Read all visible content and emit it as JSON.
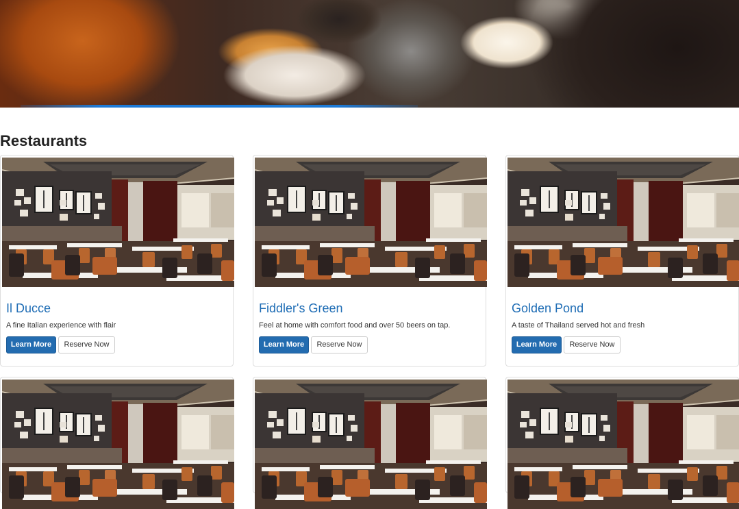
{
  "hero": {
    "image": "restaurant-dining-photo"
  },
  "page": {
    "heading": "Restaurants"
  },
  "restaurants": [
    {
      "name": "Il Ducce",
      "description": "A fine Italian experience with flair",
      "learn_more": "Learn More",
      "reserve": "Reserve Now"
    },
    {
      "name": "Fiddler's Green",
      "description": "Feel at home with comfort food and over 50 beers on tap.",
      "learn_more": "Learn More",
      "reserve": "Reserve Now"
    },
    {
      "name": "Golden Pond",
      "description": "A taste of Thailand served hot and fresh",
      "learn_more": "Learn More",
      "reserve": "Reserve Now"
    },
    {
      "name": "",
      "description": "",
      "learn_more": "",
      "reserve": ""
    },
    {
      "name": "",
      "description": "",
      "learn_more": "",
      "reserve": ""
    },
    {
      "name": "",
      "description": "",
      "learn_more": "",
      "reserve": ""
    }
  ],
  "colors": {
    "link": "#1f6db5",
    "primary_button": "#236cb0",
    "accent": "#1d7ad6"
  }
}
